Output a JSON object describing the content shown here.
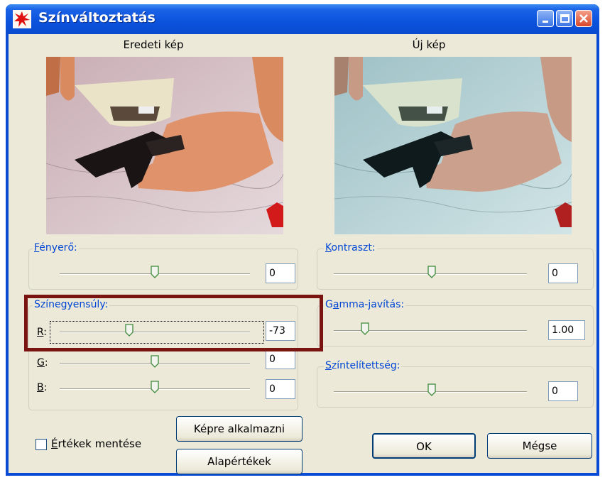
{
  "window": {
    "title": "Színváltoztatás"
  },
  "images": {
    "original_label": "Eredeti kép",
    "new_label": "Új kép"
  },
  "brightness": {
    "label_u": "F",
    "label_rest": "ényerő:",
    "value": "0"
  },
  "color_balance": {
    "label": "Színegyensúly:",
    "r": {
      "label_u": "R",
      "label_rest": ":",
      "value": "-73"
    },
    "g": {
      "label_u": "G",
      "label_rest": ":",
      "value": "0"
    },
    "b": {
      "label_u": "B",
      "label_rest": ":",
      "value": "0"
    }
  },
  "contrast": {
    "label_u": "K",
    "label_rest": "ontraszt:",
    "value": "0"
  },
  "gamma": {
    "label_pre": "G",
    "label_u": "a",
    "label_rest": "mma-javítás:",
    "value": "1.00"
  },
  "saturation": {
    "label_u": "S",
    "label_rest": "zíntelítettség:",
    "value": "0"
  },
  "save_values": {
    "label_u": "É",
    "label_rest": "rtékek mentése",
    "checked": false
  },
  "buttons": {
    "apply": "Képre alkalmazni",
    "defaults": "Alapértékek",
    "ok": "OK",
    "cancel": "Mégse"
  },
  "colors": {
    "highlight": "#7a1410",
    "titlebar": "#0a4bd6",
    "group_label": "#0046d5"
  }
}
